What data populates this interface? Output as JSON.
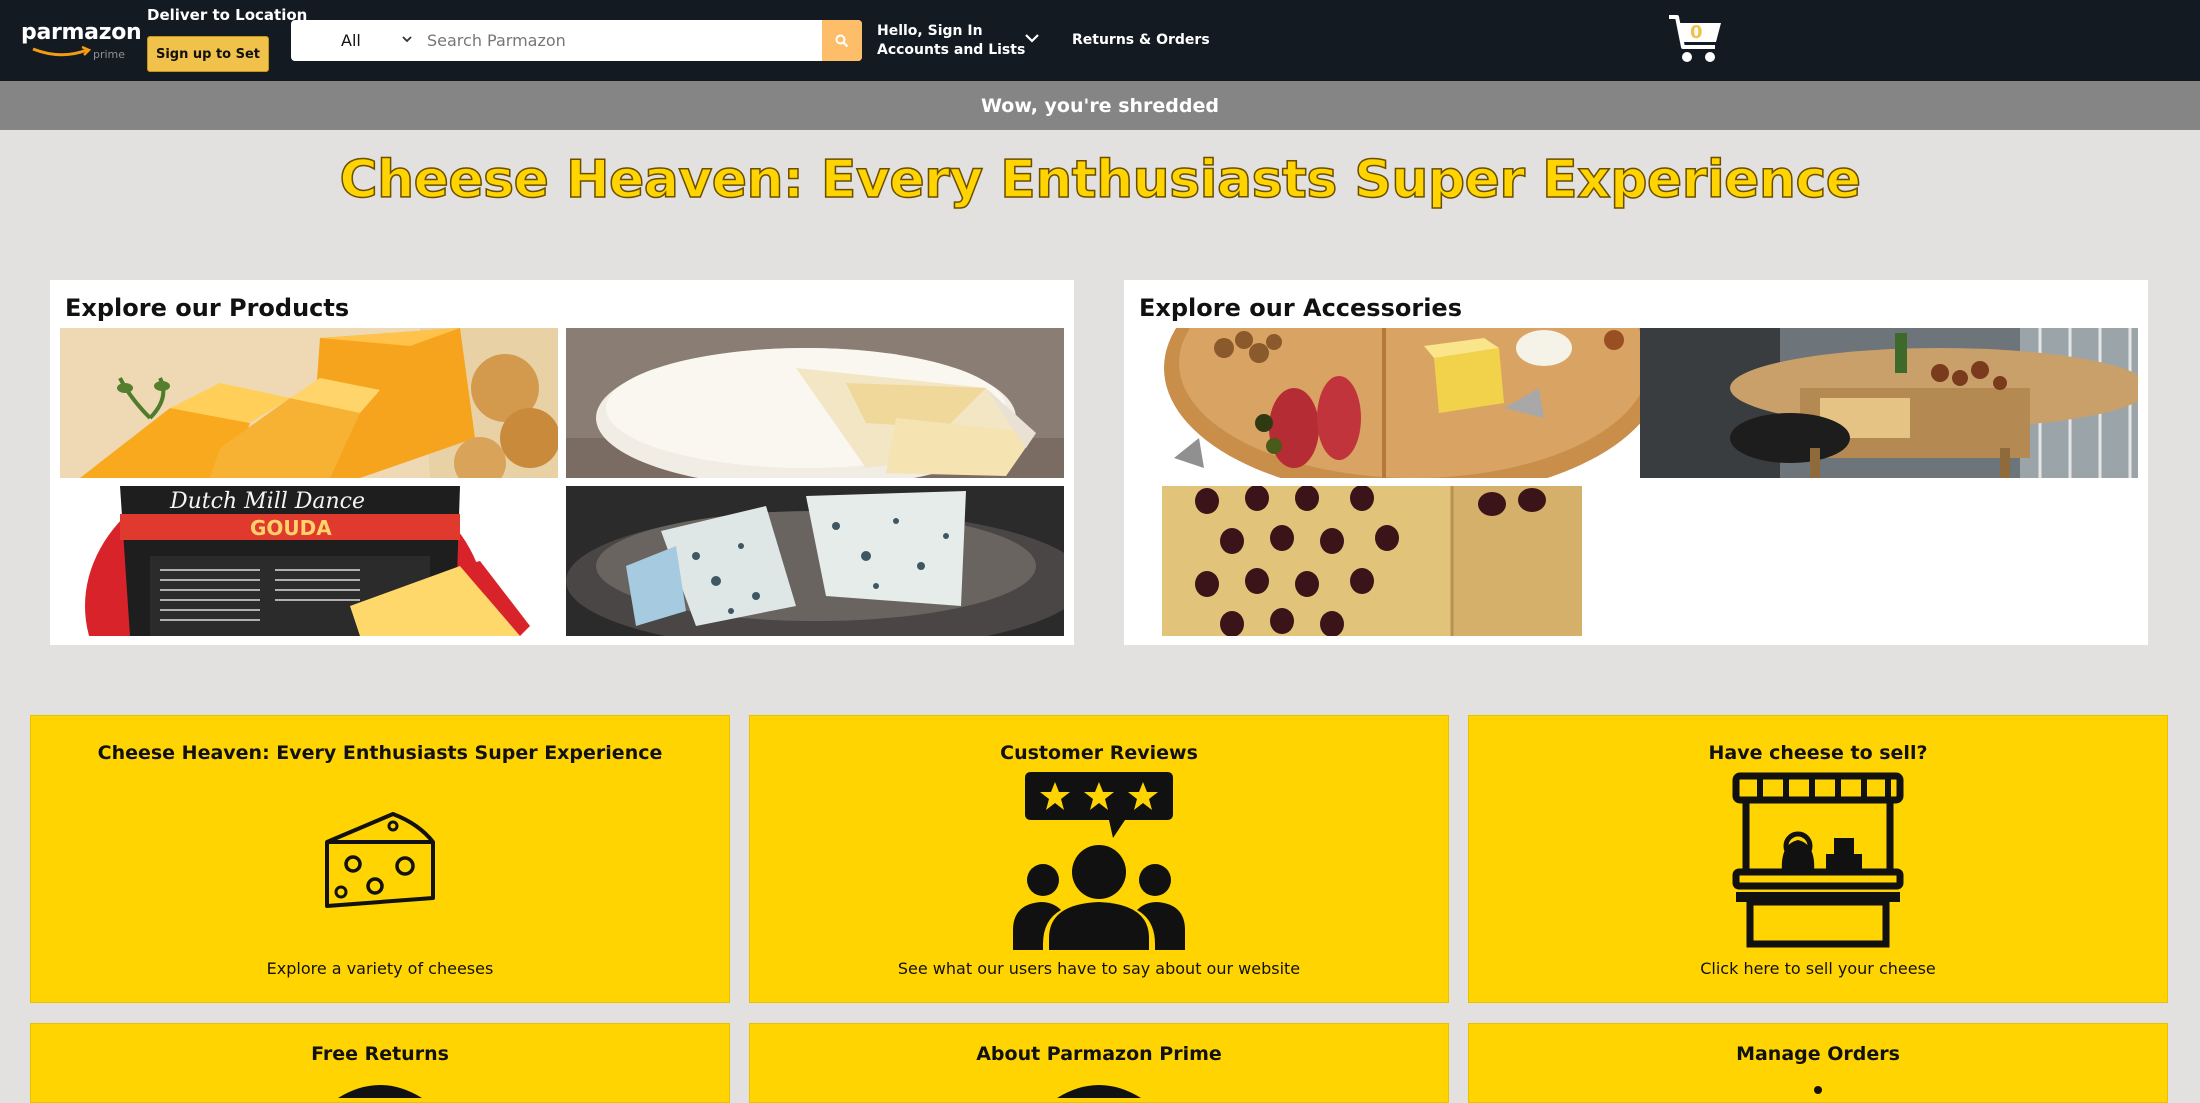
{
  "header": {
    "logo_name": "parmazon",
    "logo_sub": "prime",
    "deliver_label": "Deliver to Location",
    "signup_label": "Sign up to Set",
    "search_category": "All",
    "search_placeholder": "Search Parmazon",
    "account_line1": "Hello, Sign In",
    "account_line2": "Accounts and Lists",
    "returns_label": "Returns & Orders",
    "cart_count": "0"
  },
  "banner": {
    "text": "Wow, you're shredded"
  },
  "hero": {
    "title": "Cheese Heaven: Every Enthusiasts Super Experience"
  },
  "products": {
    "title": "Explore our Products",
    "items": [
      "cheddar cheese",
      "brie cheese",
      "gouda cheese",
      "blue cheese"
    ],
    "gouda_brand": "Dutch Mill Dance",
    "gouda_type": "GOUDA"
  },
  "accessories": {
    "title": "Explore our Accessories",
    "items": [
      "cheese board",
      "serving tray",
      "cheese grater"
    ]
  },
  "features": [
    {
      "title": "Cheese Heaven: Every Enthusiasts Super Experience",
      "desc": "Explore a variety of cheeses",
      "icon": "cheese-icon"
    },
    {
      "title": "Customer Reviews",
      "desc": "See what our users have to say about our website",
      "icon": "reviews-icon"
    },
    {
      "title": "Have cheese to sell?",
      "desc": "Click here to sell your cheese",
      "icon": "market-stall-icon"
    },
    {
      "title": "Free Returns",
      "desc": "",
      "icon": "returns-icon"
    },
    {
      "title": "About Parmazon Prime",
      "desc": "",
      "icon": "prime-icon"
    },
    {
      "title": "Manage Orders",
      "desc": "",
      "icon": "orders-icon"
    }
  ],
  "colors": {
    "header_bg": "#131a22",
    "accent": "#ffd400",
    "button": "#f0c14b",
    "banner": "#858585",
    "page_bg": "#e3e1e0"
  }
}
